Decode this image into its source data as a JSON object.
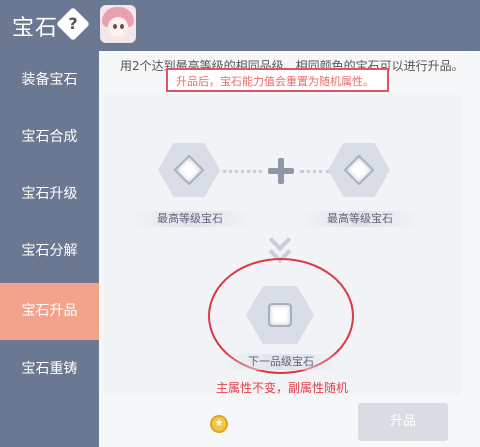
{
  "header": {
    "title": "宝石",
    "help_icon": "question-icon",
    "avatar_icon": "character-avatar-icon"
  },
  "sidebar": {
    "items": [
      {
        "label": "装备宝石"
      },
      {
        "label": "宝石合成"
      },
      {
        "label": "宝石升级"
      },
      {
        "label": "宝石分解"
      },
      {
        "label": "宝石升品",
        "active": true
      },
      {
        "label": "宝石重铸"
      }
    ],
    "active_color": "#f3a38c",
    "bg_color": "#6b7891"
  },
  "main": {
    "info_line": "用2个达到最高等级的相同品级、相同颜色的宝石可以进行升品。",
    "warning_line": "升品后，宝石能力值会重置为随机属性。",
    "slot_left_label": "最高等级宝石",
    "slot_right_label": "最高等级宝石",
    "result_label": "下一品级宝石",
    "result_note": "主属性不变，副属性随机",
    "coin_icon": "coin-icon",
    "upgrade_button": "升品",
    "accent_red": "#e2434a"
  }
}
